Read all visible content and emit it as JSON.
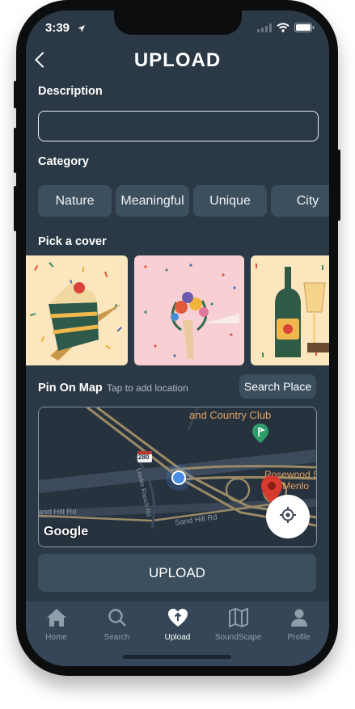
{
  "status_bar": {
    "time": "3:39"
  },
  "header": {
    "title": "UPLOAD"
  },
  "description": {
    "label": "Description",
    "value": "",
    "placeholder": ""
  },
  "category": {
    "label": "Category",
    "chips": [
      "Nature",
      "Meaningful",
      "Unique",
      "City"
    ]
  },
  "cover": {
    "label": "Pick a cover"
  },
  "map_section": {
    "label": "Pin On Map",
    "hint": "Tap to add location",
    "search_button": "Search Place",
    "map_labels": {
      "country_club": "and Country Club",
      "interstate": "280",
      "lawler": "Lawler Ranch Rd",
      "sand_hill_left": "and Hill Rd",
      "sand_hill": "Sand Hill Rd",
      "rosewood_1": "Rosewood S",
      "rosewood_2": "ill Menlo",
      "google": "Google"
    }
  },
  "upload_button": "UPLOAD",
  "tabbar": {
    "items": [
      {
        "label": "Home",
        "icon": "home-icon"
      },
      {
        "label": "Search",
        "icon": "search-icon"
      },
      {
        "label": "Upload",
        "icon": "upload-heart-icon",
        "active": true
      },
      {
        "label": "SoundScape",
        "icon": "map-icon"
      },
      {
        "label": "Profile",
        "icon": "profile-icon"
      }
    ]
  },
  "colors": {
    "background": "#2a3945",
    "surface": "#3c4f5f",
    "tabbar": "#344657",
    "map_road": "#9a8a66",
    "map_label": "#e0a060"
  }
}
